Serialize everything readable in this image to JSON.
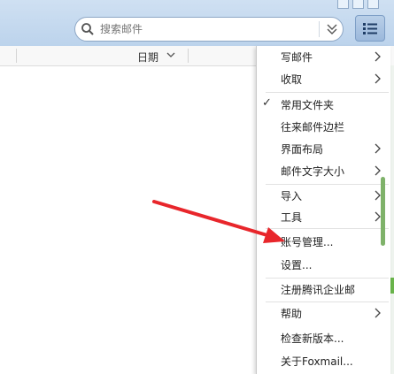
{
  "search": {
    "placeholder": "搜索邮件"
  },
  "list_header": {
    "date_label": "日期"
  },
  "menu": {
    "items": [
      {
        "label": "写邮件",
        "has_submenu": true,
        "checked": false
      },
      {
        "label": "收取",
        "has_submenu": true,
        "checked": false
      },
      {
        "label": "常用文件夹",
        "has_submenu": false,
        "checked": true
      },
      {
        "label": "往来邮件边栏",
        "has_submenu": false,
        "checked": false
      },
      {
        "label": "界面布局",
        "has_submenu": true,
        "checked": false
      },
      {
        "label": "邮件文字大小",
        "has_submenu": true,
        "checked": false
      },
      {
        "label": "导入",
        "has_submenu": true,
        "checked": false
      },
      {
        "label": "工具",
        "has_submenu": true,
        "checked": false
      },
      {
        "label": "账号管理...",
        "has_submenu": false,
        "checked": false
      },
      {
        "label": "设置...",
        "has_submenu": false,
        "checked": false
      },
      {
        "label": "注册腾讯企业邮",
        "has_submenu": false,
        "checked": false
      },
      {
        "label": "帮助",
        "has_submenu": true,
        "checked": false
      },
      {
        "label": "检查新版本...",
        "has_submenu": false,
        "checked": false
      },
      {
        "label": "关于Foxmail...",
        "has_submenu": false,
        "checked": false
      }
    ]
  },
  "colors": {
    "accent_red": "#e8262b",
    "scroll_green": "#7fb26a"
  }
}
